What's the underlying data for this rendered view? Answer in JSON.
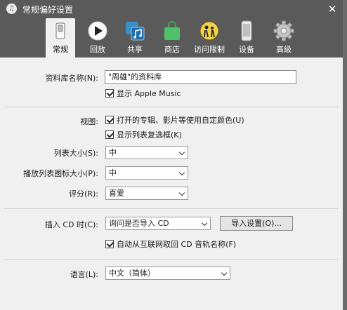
{
  "window": {
    "title": "常规偏好设置",
    "close_glyph": "✕",
    "app_glyph": "♫"
  },
  "toolbar": {
    "items": [
      {
        "label": "常规",
        "icon": "switch-icon",
        "active": true
      },
      {
        "label": "回放",
        "icon": "play-icon",
        "active": false
      },
      {
        "label": "共享",
        "icon": "share-music-icon",
        "active": false
      },
      {
        "label": "商店",
        "icon": "store-bag-icon",
        "active": false
      },
      {
        "label": "访问限制",
        "icon": "parental-control-icon",
        "active": false
      },
      {
        "label": "设备",
        "icon": "device-phone-icon",
        "active": false
      },
      {
        "label": "高级",
        "icon": "gear-icon",
        "active": false
      }
    ]
  },
  "library": {
    "name_label": "资料库名称(N):",
    "name_value": "\"周雄\"的资料库",
    "show_apple_music": "显示 Apple Music"
  },
  "view": {
    "label": "视图:",
    "custom_colors": "打开的专辑、影片等使用自定颜色(U)",
    "show_checkboxes": "显示列表复选框(K)"
  },
  "list_size": {
    "label": "列表大小(S):",
    "value": "中"
  },
  "icon_size": {
    "label": "播放列表图标大小(P):",
    "value": "中"
  },
  "rating": {
    "label": "评分(R):",
    "value": "喜爱"
  },
  "cd": {
    "label": "插入 CD 时(C):",
    "value": "询问是否导入 CD",
    "import_button": "导入设置(O)...",
    "auto_fetch": "自动从互联网取回 CD 音轨名称(F)"
  },
  "language": {
    "label": "语言(L):",
    "value": "中文（简体）"
  },
  "colors": {
    "titlebar": "#5a5a5a",
    "content": "#f0f0f0"
  }
}
